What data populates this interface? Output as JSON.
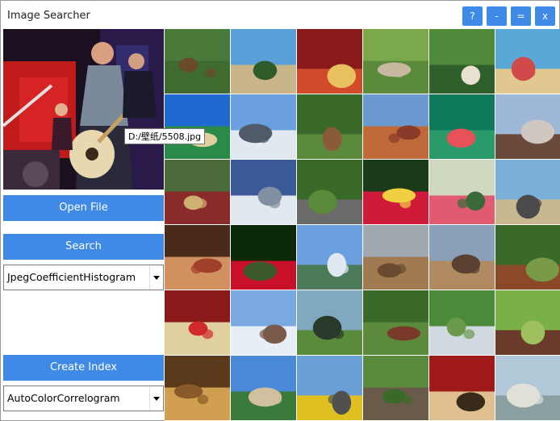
{
  "window": {
    "title": "Image Searcher"
  },
  "window_buttons": [
    "?",
    "-",
    "=",
    "x"
  ],
  "preview": {
    "tooltip": "D:/壁纸/5508.jpg"
  },
  "controls": {
    "open_file": "Open File",
    "search": "Search",
    "search_feature": "JpegCoefficientHistogram",
    "create_index": "Create Index",
    "index_feature": "AutoColorCorrelogram"
  },
  "thumbnails": [
    {
      "scene": "horses-field",
      "colors": [
        "#4a7a3a",
        "#3f6b2f",
        "#6b4a2a"
      ]
    },
    {
      "scene": "savanna-tree",
      "colors": [
        "#5aa0d8",
        "#c9b58a",
        "#2f5a2a"
      ]
    },
    {
      "scene": "food-plate",
      "colors": [
        "#8a1a1a",
        "#d14a2a",
        "#e8c060"
      ]
    },
    {
      "scene": "horse-grazing",
      "colors": [
        "#7ba84a",
        "#5a8a3a",
        "#c8b8a0"
      ]
    },
    {
      "scene": "horses-grass",
      "colors": [
        "#4f8a3a",
        "#2f5f2a",
        "#e8e0d0"
      ]
    },
    {
      "scene": "beach-sail",
      "colors": [
        "#5aa8d8",
        "#e0c890",
        "#d04a4a"
      ]
    },
    {
      "scene": "palm-beach",
      "colors": [
        "#1f6ad0",
        "#2a8a4a",
        "#e0d0a0"
      ]
    },
    {
      "scene": "glacier-people",
      "colors": [
        "#6aa0e0",
        "#e0e8f0",
        "#505a6a"
      ]
    },
    {
      "scene": "horses-meadow",
      "colors": [
        "#3a6a2a",
        "#5a8a3a",
        "#8a5a3a"
      ]
    },
    {
      "scene": "canyon-sky",
      "colors": [
        "#6a9ad0",
        "#c06a3a",
        "#8a3a2a"
      ]
    },
    {
      "scene": "red-roses",
      "colors": [
        "#0f7a5a",
        "#2a9a6a",
        "#e8505a"
      ]
    },
    {
      "scene": "mountains-rock",
      "colors": [
        "#a0b8d8",
        "#6a4a3a",
        "#d0c8c0"
      ]
    },
    {
      "scene": "tribal",
      "colors": [
        "#4a6a3a",
        "#8a2a2a",
        "#d0b070"
      ]
    },
    {
      "scene": "snow-peaks",
      "colors": [
        "#3a5a9a",
        "#e0e8f0",
        "#8090a0"
      ]
    },
    {
      "scene": "elephant",
      "colors": [
        "#3a6a2a",
        "#6a6a6a",
        "#5a8a3a"
      ]
    },
    {
      "scene": "red-flower",
      "colors": [
        "#1a3a1a",
        "#d01a3a",
        "#f0d040"
      ]
    },
    {
      "scene": "pink-roses",
      "colors": [
        "#d0d8c0",
        "#e05a70",
        "#3a6a3a"
      ]
    },
    {
      "scene": "elephant-plain",
      "colors": [
        "#7ab0d8",
        "#c8b890",
        "#4a4a4a"
      ]
    },
    {
      "scene": "feast",
      "colors": [
        "#4a2a1a",
        "#d09060",
        "#a0402a"
      ]
    },
    {
      "scene": "red-rose",
      "colors": [
        "#0a2a0a",
        "#c8102a",
        "#3a5a2a"
      ]
    },
    {
      "scene": "mountain-lake",
      "colors": [
        "#6aa0e0",
        "#4a7a5a",
        "#e0e8f0"
      ]
    },
    {
      "scene": "colosseum",
      "colors": [
        "#a0a8b0",
        "#a07a50",
        "#6a4a30"
      ]
    },
    {
      "scene": "colosseum-2",
      "colors": [
        "#8aa0b8",
        "#b08a60",
        "#5a4030"
      ]
    },
    {
      "scene": "horses-trees",
      "colors": [
        "#3a6a2a",
        "#8a4a2a",
        "#7a9a4a"
      ]
    },
    {
      "scene": "face-paint",
      "colors": [
        "#8a1a1a",
        "#e0d0a0",
        "#d02a2a"
      ]
    },
    {
      "scene": "snow-village",
      "colors": [
        "#7aa8e0",
        "#e8eef5",
        "#7a5a4a"
      ]
    },
    {
      "scene": "elephant-tree",
      "colors": [
        "#80a8c0",
        "#5a8a3a",
        "#2a3a2a"
      ]
    },
    {
      "scene": "horses-green",
      "colors": [
        "#3a6a2a",
        "#5a8a3a",
        "#7a3a2a"
      ]
    },
    {
      "scene": "white-horse",
      "colors": [
        "#4a8a3a",
        "#d0d8e0",
        "#6a9a4a"
      ]
    },
    {
      "scene": "horses-pair",
      "colors": [
        "#7ab04a",
        "#6a3a2a",
        "#a0c060"
      ]
    },
    {
      "scene": "gold-crafts",
      "colors": [
        "#5a3a1a",
        "#d0a050",
        "#8a5a2a"
      ]
    },
    {
      "scene": "resort-palms",
      "colors": [
        "#4a8ad8",
        "#3a7a3a",
        "#d0c0a0"
      ]
    },
    {
      "scene": "bus-street",
      "colors": [
        "#6aa0d8",
        "#e0c020",
        "#505050"
      ]
    },
    {
      "scene": "horse-riders",
      "colors": [
        "#5a8a3a",
        "#6a5a4a",
        "#3a6a2a"
      ]
    },
    {
      "scene": "food-skewers",
      "colors": [
        "#a01a1a",
        "#e0c090",
        "#3a2a1a"
      ]
    },
    {
      "scene": "surf-beach",
      "colors": [
        "#b0c8d8",
        "#8aa0a0",
        "#e0e0d8"
      ]
    }
  ]
}
